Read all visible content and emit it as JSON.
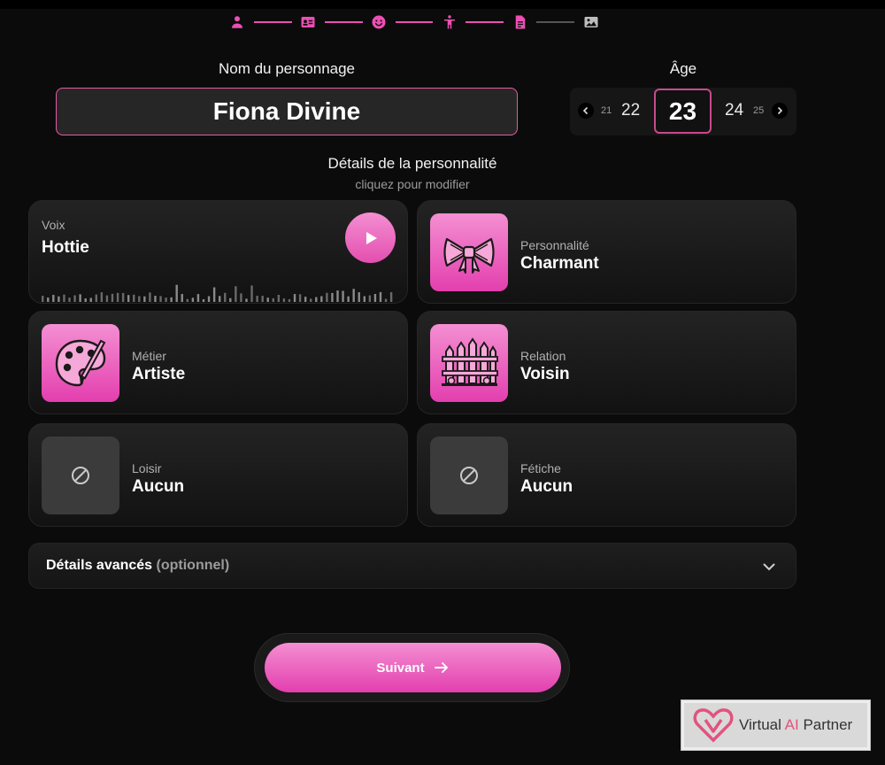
{
  "progress": {
    "steps": [
      {
        "icon": "user-icon",
        "active": true
      },
      {
        "icon": "id-card-icon",
        "active": true
      },
      {
        "icon": "smiley-icon",
        "active": true
      },
      {
        "icon": "body-icon",
        "active": true
      },
      {
        "icon": "document-icon",
        "active": true
      },
      {
        "icon": "image-icon",
        "active": false
      }
    ],
    "accent": "#ec4fb3"
  },
  "name_section": {
    "label": "Nom du personnage",
    "value": "Fiona Divine"
  },
  "age_section": {
    "label": "Âge",
    "values": {
      "far_left": "21",
      "left": "22",
      "selected": "23",
      "right": "24",
      "far_right": "25"
    }
  },
  "details": {
    "title": "Détails de la personnalité",
    "subtitle": "cliquez pour modifier",
    "voice": {
      "category": "Voix",
      "value": "Hottie"
    },
    "personality": {
      "category": "Personnalité",
      "value": "Charmant",
      "icon": "bow-icon"
    },
    "job": {
      "category": "Métier",
      "value": "Artiste",
      "icon": "palette-icon"
    },
    "relation": {
      "category": "Relation",
      "value": "Voisin",
      "icon": "fence-icon"
    },
    "hobby": {
      "category": "Loisir",
      "value": "Aucun",
      "icon": "none-icon"
    },
    "fetish": {
      "category": "Fétiche",
      "value": "Aucun",
      "icon": "none-icon"
    }
  },
  "advanced": {
    "label": "Détails avancés",
    "optional": "(optionnel)"
  },
  "next_button": {
    "label": "Suivant"
  },
  "watermark": {
    "prefix": "Virtual ",
    "ai": "AI",
    "suffix": " Partner"
  },
  "colors": {
    "accent": "#e33fae",
    "background": "#0b0b0b",
    "card": "#1a1a1a"
  }
}
